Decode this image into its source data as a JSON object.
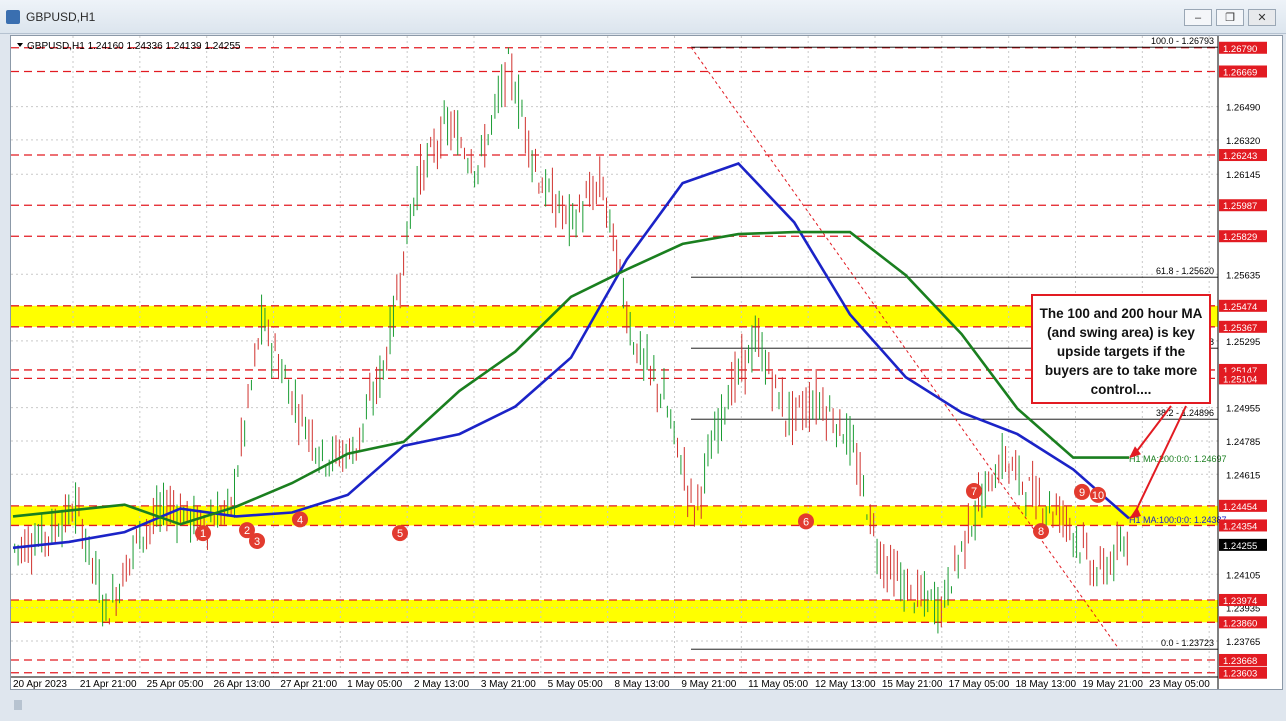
{
  "window": {
    "title": "GBPUSD,H1",
    "minimize_label": "–",
    "maximize_label": "❐",
    "close_label": "✕",
    "icon": "chart-app-icon"
  },
  "chart_header": "GBPUSD,H1  1.24160 1.24336 1.24139 1.24255",
  "callout_text": "The 100 and 200 hour MA (and swing area) is key upside targets if the buyers are to take more control....",
  "colors": {
    "candle": "#1a9c33",
    "candle_down": "#d0312d",
    "ma100": "#1b23c7",
    "ma200": "#1a7f1f",
    "highlight": "#ffff00",
    "dashed": "#e21b22",
    "price_tag": "#e21b22",
    "current_tag": "#000000"
  },
  "chart_data": {
    "type": "line",
    "symbol": "GBPUSD",
    "timeframe": "H1",
    "ylim": [
      1.2352,
      1.2685
    ],
    "x_ticks": [
      "20 Apr 2023",
      "21 Apr 21:00",
      "25 Apr 05:00",
      "26 Apr 13:00",
      "27 Apr 21:00",
      "1 May 05:00",
      "2 May 13:00",
      "3 May 21:00",
      "5 May 05:00",
      "8 May 13:00",
      "9 May 21:00",
      "11 May 05:00",
      "12 May 13:00",
      "15 May 21:00",
      "17 May 05:00",
      "18 May 13:00",
      "19 May 21:00",
      "23 May 05:00"
    ],
    "y_ticks": [
      "1.26490",
      "1.26320",
      "1.26145",
      "1.25635",
      "1.25295",
      "1.24955",
      "1.24785",
      "1.24615",
      "1.24105",
      "1.23935",
      "1.23765"
    ],
    "price_tags": [
      "1.26790",
      "1.26669",
      "1.26243",
      "1.25987",
      "1.25829",
      "1.25474",
      "1.25367",
      "1.25147",
      "1.25104",
      "1.24454",
      "1.24354",
      "1.23974",
      "1.23860",
      "1.23668",
      "1.23603"
    ],
    "current_price": "1.24255",
    "series": [
      {
        "name": "100 hour MA",
        "values": [
          1.2424,
          1.2427,
          1.2432,
          1.2444,
          1.244,
          1.2442,
          1.2451,
          1.2476,
          1.2482,
          1.2496,
          1.2521,
          1.2571,
          1.261,
          1.262,
          1.259,
          1.2543,
          1.2511,
          1.2493,
          1.2482,
          1.2464,
          1.2439
        ]
      },
      {
        "name": "200 hour MA",
        "values": [
          1.244,
          1.2443,
          1.2446,
          1.2436,
          1.2445,
          1.2457,
          1.2472,
          1.2478,
          1.2504,
          1.2524,
          1.2552,
          1.2566,
          1.2579,
          1.2584,
          1.2585,
          1.2585,
          1.2563,
          1.2533,
          1.2495,
          1.247,
          1.247
        ]
      }
    ],
    "ma_labels": [
      {
        "text": "H1 MA:200:0:0: 1.24697"
      },
      {
        "text": "H1 MA:100:0:0: 1.24387"
      }
    ],
    "fibonacci": [
      {
        "label": "100.0 - 1.26793",
        "value": 1.26793
      },
      {
        "label": "61.8 - 1.25620",
        "value": 1.2562
      },
      {
        "label": "5258",
        "value": 1.25258
      },
      {
        "label": "38.2 - 1.24896",
        "value": 1.24896
      },
      {
        "label": "0.0 - 1.23723",
        "value": 1.23723
      }
    ],
    "zones": [
      {
        "from": 1.25367,
        "to": 1.25474
      },
      {
        "from": 1.24354,
        "to": 1.24454
      },
      {
        "from": 1.2386,
        "to": 1.23974
      }
    ],
    "swing_markers": [
      "1",
      "2",
      "3",
      "4",
      "5",
      "6",
      "7",
      "8",
      "9",
      "10"
    ]
  }
}
